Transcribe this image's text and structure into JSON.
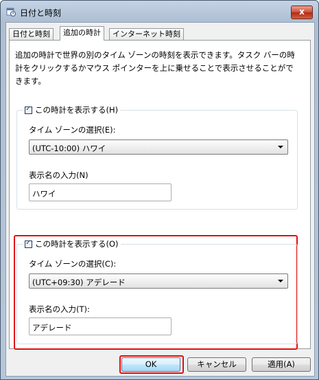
{
  "window": {
    "title": "日付と時刻",
    "icon": "calendar-clock-icon",
    "close_label": "x"
  },
  "tabs": [
    {
      "label": "日付と時刻",
      "active": false
    },
    {
      "label": "追加の時計",
      "active": true
    },
    {
      "label": "インターネット時刻",
      "active": false
    }
  ],
  "description": "追加の時計で世界の別のタイム ゾーンの時刻を表示できます。タスク バーの時計をクリックするかマウス ポインターを上に乗せることで表示させることができます。",
  "clock1": {
    "show_label": "この時計を表示する(H)",
    "checked": true,
    "timezone_label": "タイム ゾーンの選択(E):",
    "timezone_value": "(UTC-10:00) ハワイ",
    "name_label": "表示名の入力(N)",
    "name_value": "ハワイ"
  },
  "clock2": {
    "show_label": "この時計を表示する(O)",
    "checked": true,
    "timezone_label": "タイム ゾーンの選択(C):",
    "timezone_value": "(UTC+09:30) アデレード",
    "name_label": "表示名の入力(T):",
    "name_value": "アデレード"
  },
  "buttons": {
    "ok": "OK",
    "cancel": "キャンセル",
    "apply": "適用(A)"
  },
  "colors": {
    "highlight": "#e01010"
  }
}
